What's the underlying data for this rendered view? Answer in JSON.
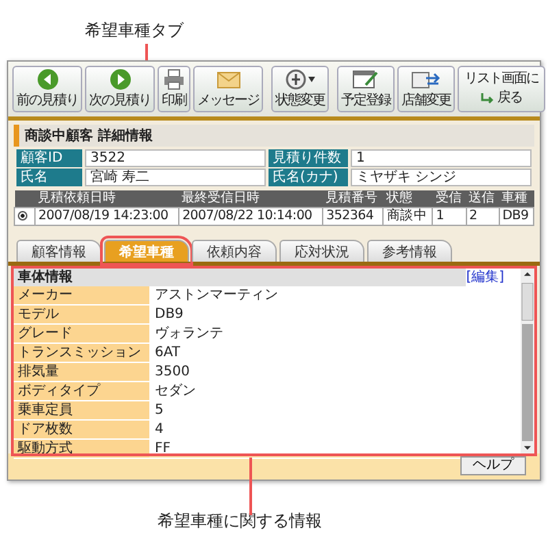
{
  "callouts": [
    {
      "text": "希望車種タブ"
    },
    {
      "text": "希望車種に関する情報"
    }
  ],
  "toolbar": {
    "buttons": [
      {
        "label": "前の見積り",
        "dropdown": false
      },
      {
        "label": "次の見積り",
        "dropdown": false
      },
      {
        "label": "印刷",
        "dropdown": false
      },
      {
        "label": "メッセージ",
        "dropdown": false
      },
      {
        "label": "状態変更",
        "dropdown": true
      },
      {
        "label": "予定登録",
        "dropdown": false
      },
      {
        "label": "店舗変更",
        "dropdown": false
      }
    ],
    "return_button": {
      "line_1": "リスト画面に",
      "line_2": "戻る"
    }
  },
  "panel": {
    "title": "商談中顧客  詳細情報",
    "fields": [
      {
        "label": "顧客ID",
        "value": "3522"
      },
      {
        "label": "見積り件数",
        "value": "1"
      },
      {
        "label": "氏名",
        "value": "宮崎 寿二"
      },
      {
        "label": "氏名(カナ)",
        "value": "ミヤザキ シンジ"
      }
    ]
  },
  "estimates": {
    "columns": [
      "見積依頼日時",
      "最終受信日時",
      "見積番号",
      "状態",
      "受信",
      "送信",
      "車種"
    ],
    "rows": [
      {
        "selected": true,
        "cells": [
          "2007/08/19 14:23:00",
          "2007/08/22 10:14:00",
          "352364",
          "商談中",
          "1",
          "2",
          "DB9"
        ]
      }
    ]
  },
  "tabs": [
    {
      "label": "顧客情報",
      "selected": false
    },
    {
      "label": "希望車種",
      "selected": true
    },
    {
      "label": "依頼内容",
      "selected": false
    },
    {
      "label": "応対状況",
      "selected": false
    },
    {
      "label": "参考情報",
      "selected": false
    }
  ],
  "spec": {
    "section": "車体情報",
    "edit_link": "[編集]",
    "rows": [
      {
        "label": "メーカー",
        "value": "アストンマーティン"
      },
      {
        "label": "モデル",
        "value": "DB9"
      },
      {
        "label": "グレード",
        "value": "ヴォランテ"
      },
      {
        "label": "トランスミッション",
        "value": "6AT"
      },
      {
        "label": "排気量",
        "value": "3500"
      },
      {
        "label": "ボディタイプ",
        "value": "セダン"
      },
      {
        "label": "乗車定員",
        "value": "5"
      },
      {
        "label": "ドア枚数",
        "value": "4"
      },
      {
        "label": "駆動方式",
        "value": "FF"
      }
    ]
  },
  "help_button": "ヘルプ"
}
